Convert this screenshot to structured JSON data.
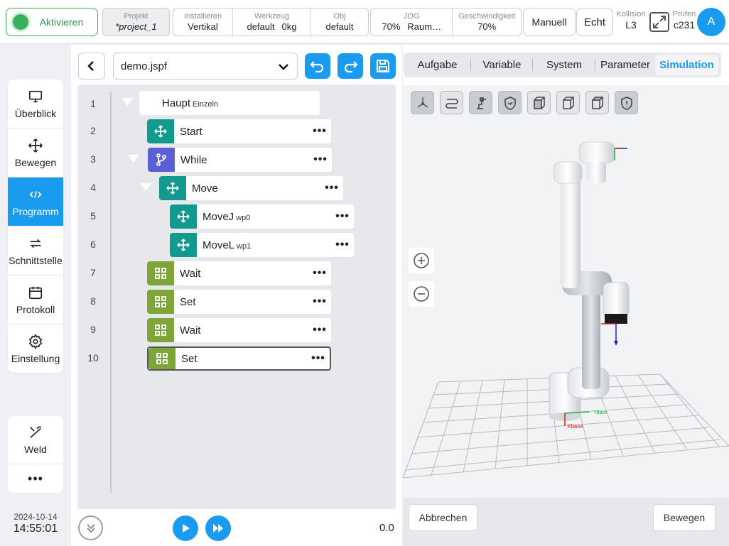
{
  "topbar": {
    "activate_label": "Aktivieren",
    "project_caption": "Projekt",
    "project_value": "*project_1",
    "install_caption": "Installieren",
    "install_value": "Vertikal",
    "tool_caption": "Werkzeug",
    "tool_value": "default",
    "tool_weight": "0kg",
    "obj_caption": "Obj",
    "obj_value": "default",
    "jog_caption": "JOG",
    "jog_value": "70%",
    "jog_frame": "Raum…",
    "speed_caption": "Geschwindigkeit",
    "speed_value": "70%",
    "mode_label": "Manuell",
    "real_label": "Echt",
    "collision_caption": "Kollision",
    "collision_value": "L3",
    "check_caption": "Prüfen",
    "check_value": "c231",
    "avatar_letter": "A"
  },
  "sidebar": {
    "items": [
      {
        "label": "Überblick",
        "icon": "monitor-icon"
      },
      {
        "label": "Bewegen",
        "icon": "move-icon"
      },
      {
        "label": "Programm",
        "icon": "code-icon"
      },
      {
        "label": "Schnittstelle",
        "icon": "swap-icon"
      },
      {
        "label": "Protokoll",
        "icon": "calendar-icon"
      },
      {
        "label": "Einstellung",
        "icon": "gear-icon"
      }
    ],
    "weld_label": "Weld",
    "more_label": "•••"
  },
  "clock": {
    "date": "2024-10-14",
    "time": "14:55:01"
  },
  "program": {
    "file_name": "demo.jspf",
    "speed_value": "0.0",
    "nodes": [
      {
        "line": "1",
        "label": "Haupt",
        "sub": "Einzeln"
      },
      {
        "line": "2",
        "label": "Start",
        "sub": ""
      },
      {
        "line": "3",
        "label": "While",
        "sub": ""
      },
      {
        "line": "4",
        "label": "Move",
        "sub": ""
      },
      {
        "line": "5",
        "label": "MoveJ",
        "sub": "wp0"
      },
      {
        "line": "6",
        "label": "MoveL",
        "sub": "wp1"
      },
      {
        "line": "7",
        "label": "Wait",
        "sub": ""
      },
      {
        "line": "8",
        "label": "Set",
        "sub": ""
      },
      {
        "line": "9",
        "label": "Wait",
        "sub": ""
      },
      {
        "line": "10",
        "label": "Set",
        "sub": ""
      }
    ],
    "more_label": "•••"
  },
  "simulation": {
    "tabs": [
      "Aufgabe",
      "Variable",
      "System",
      "Parameter",
      "Simulation"
    ],
    "active_tab": "Simulation",
    "axis_x_label": "Xbase",
    "axis_y_label": "Ybase",
    "cancel_label": "Abbrechen",
    "move_label": "Bewegen"
  },
  "colors": {
    "accent": "#1a9bf0",
    "active_green": "#3bb05c",
    "node_teal": "#139a8e",
    "node_purple": "#5b5fd6",
    "node_olive": "#7ea53a"
  }
}
